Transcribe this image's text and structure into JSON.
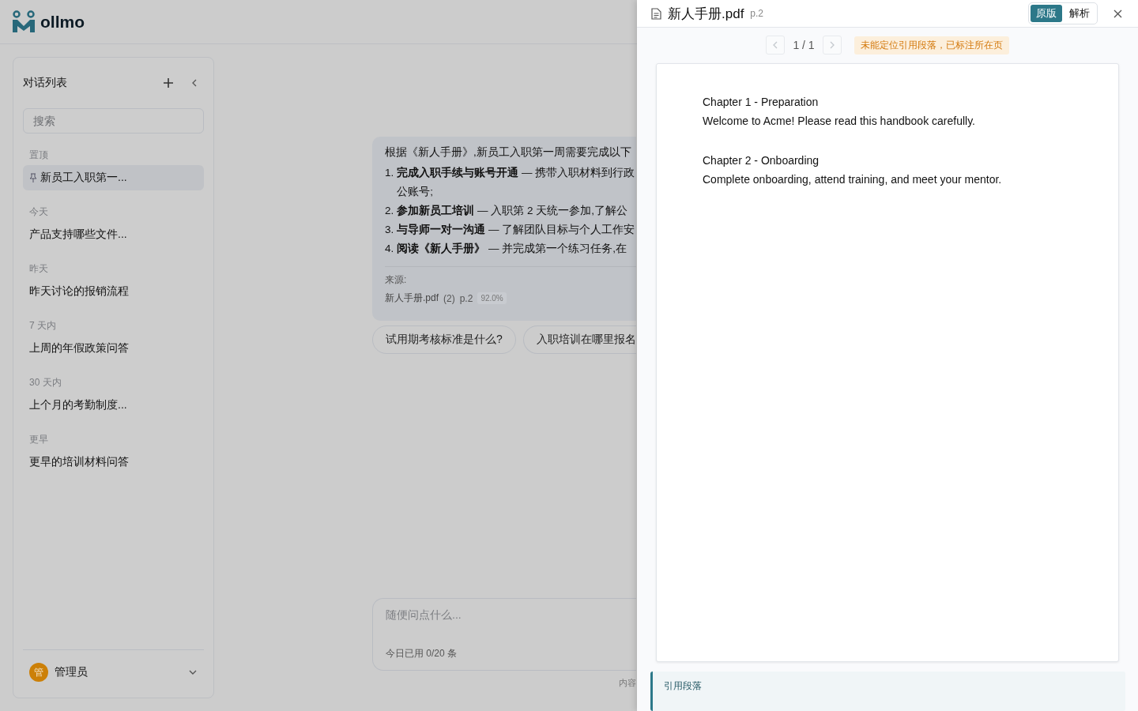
{
  "app": {
    "name": "ollmo"
  },
  "sidebar": {
    "title": "对话列表",
    "search": {
      "placeholder": "搜索"
    },
    "groups": [
      {
        "label": "置顶",
        "items": [
          {
            "title": "新员工入职第一...",
            "pinned": true,
            "selected": true
          }
        ]
      },
      {
        "label": "今天",
        "items": [
          {
            "title": "产品支持哪些文件...",
            "pinned": false,
            "selected": false
          }
        ]
      },
      {
        "label": "昨天",
        "items": [
          {
            "title": "昨天讨论的报销流程",
            "pinned": false,
            "selected": false
          }
        ]
      },
      {
        "label": "7 天内",
        "items": [
          {
            "title": "上周的年假政策问答",
            "pinned": false,
            "selected": false
          }
        ]
      },
      {
        "label": "30 天内",
        "items": [
          {
            "title": "上个月的考勤制度...",
            "pinned": false,
            "selected": false
          }
        ]
      },
      {
        "label": "更早",
        "items": [
          {
            "title": "更早的培训材料问答",
            "pinned": false,
            "selected": false
          }
        ]
      }
    ],
    "user": {
      "avatar": "管",
      "name": "管理员"
    }
  },
  "chat": {
    "answer": {
      "intro": "根据《新人手册》,新员工入职第一周需要完成以下",
      "items": [
        {
          "number": "1.",
          "lines": [
            "**完成入职手续与账号开通** — 携带入职材料到行政",
            "公账号;"
          ]
        },
        {
          "number": "2.",
          "lines": [
            "**参加新员工培训** — 入职第 2 天统一参加,了解公"
          ]
        },
        {
          "number": "3.",
          "lines": [
            "**与导师一对一沟通** — 了解团队目标与个人工作安"
          ]
        },
        {
          "number": "4.",
          "lines": [
            "**阅读《新人手册》** — 并完成第一个练习任务,在"
          ]
        }
      ],
      "source_label": "来源:",
      "sources": [
        {
          "file": "新人手册.pdf",
          "count": "(2)",
          "page": "p.2",
          "score": "92.0%"
        }
      ]
    },
    "suggestions": [
      "试用期考核标准是什么?",
      "入职培训在哪里报名"
    ],
    "input": {
      "placeholder": "随便问点什么...",
      "usage": "今日已用 0/20 条"
    },
    "footer": "内容"
  },
  "viewer": {
    "file": "新人手册.pdf",
    "page": "p.2",
    "modes": [
      {
        "label": "原版",
        "selected": true
      },
      {
        "label": "解析",
        "selected": false
      }
    ],
    "pager": {
      "position": "1 / 1",
      "buttons": [
        {
          "kind": "prev",
          "disabled": true
        },
        {
          "kind": "next",
          "disabled": true
        }
      ]
    },
    "notice": "未能定位引用段落，已标注所在页",
    "document": {
      "blocks": [
        {
          "kind": "heading",
          "text": "Chapter 1 - Preparation"
        },
        {
          "kind": "paragraph",
          "text": "Welcome to Acme! Please read this handbook carefully."
        },
        {
          "kind": "heading",
          "text": "Chapter 2 - Onboarding"
        },
        {
          "kind": "paragraph",
          "text": "Complete onboarding, attend training, and meet your mentor."
        }
      ]
    },
    "quote": {
      "title": "引用段落"
    }
  }
}
